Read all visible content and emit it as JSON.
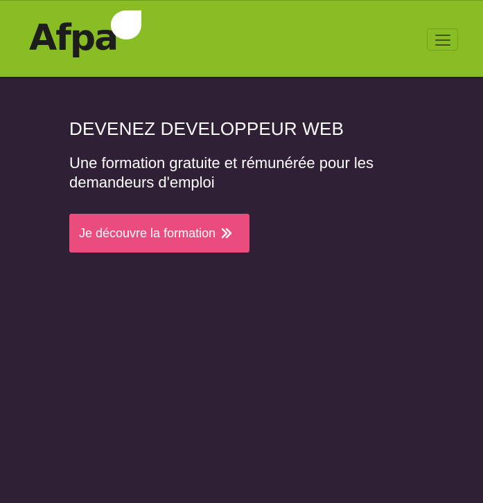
{
  "header": {
    "logo_text": "Afpa",
    "menu_toggle": "menu",
    "icons": {
      "leaf": "leaf-icon",
      "menu": "hamburger-icon"
    },
    "colors": {
      "navbar_bg": "#88bd23",
      "leaf": "#ffffff",
      "logo_text": "#1d1d1b"
    }
  },
  "hero": {
    "title": "DEVENEZ DEVELOPPEUR WEB",
    "subtitle": "Une formation gratuite et rémunérée pour les demandeurs d'emploi",
    "cta_label": "Je découvre la formation",
    "cta_icon": "double-chevron-right-icon",
    "colors": {
      "background": "#2f2036",
      "cta_bg": "#ea4c7d",
      "text": "#ffffff"
    }
  }
}
